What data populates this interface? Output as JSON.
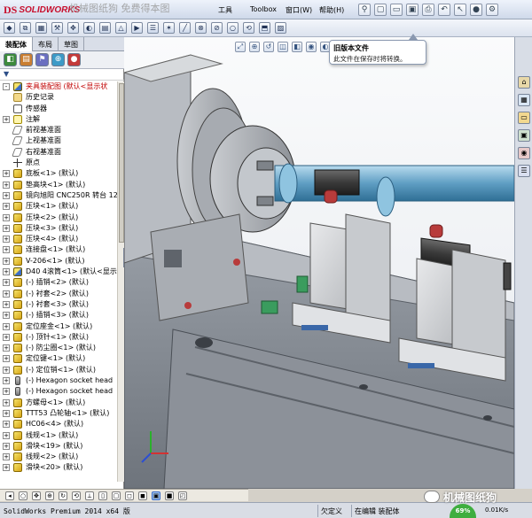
{
  "app": {
    "logo_text": "SOLIDWORKS",
    "watermark": "机械图纸狗 免费得本图",
    "menu": {
      "tools": "工具",
      "toolbox": "Toolbox",
      "window": "窗口(W)",
      "help": "帮助(H)"
    }
  },
  "feature_manager": {
    "tabs": [
      "装配体",
      "布局",
      "草图"
    ],
    "tree": [
      {
        "label": "夹具装配图  (默认<显示状",
        "icon": "asm",
        "expand": "-",
        "root": true
      },
      {
        "label": "历史记录",
        "icon": "folder",
        "expand": ""
      },
      {
        "label": "传感器",
        "icon": "sensor",
        "expand": ""
      },
      {
        "label": "注解",
        "icon": "note",
        "expand": "+"
      },
      {
        "label": "前视基准面",
        "icon": "plane",
        "expand": ""
      },
      {
        "label": "上视基准面",
        "icon": "plane",
        "expand": ""
      },
      {
        "label": "右视基准面",
        "icon": "plane",
        "expand": ""
      },
      {
        "label": "原点",
        "icon": "origin",
        "expand": ""
      },
      {
        "label": "底板<1> (默认)",
        "icon": "part",
        "expand": "+"
      },
      {
        "label": "垫高块<1> (默认)",
        "icon": "part",
        "expand": "+"
      },
      {
        "label": "镜向旭阳 CNC250R 转台 12",
        "icon": "part",
        "expand": "+"
      },
      {
        "label": "压块<1> (默认)",
        "icon": "part",
        "expand": "+"
      },
      {
        "label": "压块<2> (默认)",
        "icon": "part",
        "expand": "+"
      },
      {
        "label": "压块<3> (默认)",
        "icon": "part",
        "expand": "+"
      },
      {
        "label": "压块<4> (默认)",
        "icon": "part",
        "expand": "+"
      },
      {
        "label": "连接盘<1> (默认)",
        "icon": "part",
        "expand": "+"
      },
      {
        "label": "V-206<1> (默认)",
        "icon": "part",
        "expand": "+"
      },
      {
        "label": "D40 4滚筒<1> (默认<显示状",
        "icon": "asm",
        "expand": "+"
      },
      {
        "label": "(-) 插销<2> (默认)",
        "icon": "part",
        "expand": "+"
      },
      {
        "label": "(-) 衬套<2> (默认)",
        "icon": "part",
        "expand": "+"
      },
      {
        "label": "(-) 衬套<3> (默认)",
        "icon": "part",
        "expand": "+"
      },
      {
        "label": "(-) 插销<3> (默认)",
        "icon": "part",
        "expand": "+"
      },
      {
        "label": "定位座金<1> (默认)",
        "icon": "part",
        "expand": "+"
      },
      {
        "label": "(-) 顶针<1> (默认)",
        "icon": "part",
        "expand": "+"
      },
      {
        "label": "(-) 防尘圈<1> (默认)",
        "icon": "part",
        "expand": "+"
      },
      {
        "label": "定位键<1> (默认)",
        "icon": "part",
        "expand": "+"
      },
      {
        "label": "(-) 定位销<1> (默认)",
        "icon": "part",
        "expand": "+"
      },
      {
        "label": "(-) Hexagon socket head",
        "icon": "screw",
        "expand": "+"
      },
      {
        "label": "(-) Hexagon socket head",
        "icon": "screw",
        "expand": "+"
      },
      {
        "label": "方螺母<1> (默认)",
        "icon": "part",
        "expand": "+"
      },
      {
        "label": "TTT53 凸轮轴<1> (默认)",
        "icon": "part",
        "expand": "+"
      },
      {
        "label": "HC06<4> (默认)",
        "icon": "part",
        "expand": "+"
      },
      {
        "label": "线规<1> (默认)",
        "icon": "part",
        "expand": "+"
      },
      {
        "label": "滑块<19> (默认)",
        "icon": "part",
        "expand": "+"
      },
      {
        "label": "线规<2> (默认)",
        "icon": "part",
        "expand": "+"
      },
      {
        "label": "滑块<20> (默认)",
        "icon": "part",
        "expand": "+"
      }
    ]
  },
  "tooltip": {
    "title": "旧版本文件",
    "body": "此文件在保存时将转换。"
  },
  "status": {
    "product": "SolidWorks Premium 2014 x64 版",
    "state": "欠定义",
    "mode": "在编辑 装配体",
    "cpu": "69%",
    "speed": "0.01K/s"
  },
  "wechat_watermark": "机械图纸狗",
  "colors": {
    "accent_red": "#c8102e",
    "machine_blue": "#6ca7c9",
    "clamp_red": "#b83b3b",
    "green_part": "#3a9c5e"
  }
}
